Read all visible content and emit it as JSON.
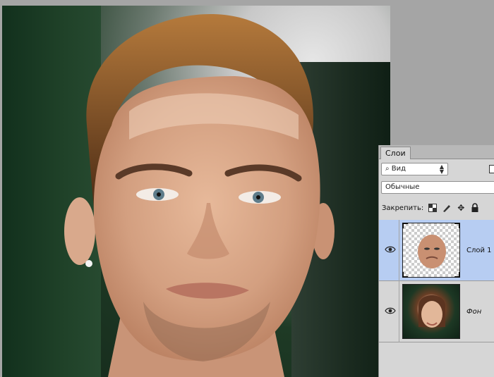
{
  "panel": {
    "tab_label": "Слои",
    "filter": {
      "icon": "search-icon",
      "value": "Вид"
    },
    "blend_mode": "Обычные",
    "lock_label": "Закрепить:",
    "lock_icons": [
      "lock-transparency-icon",
      "lock-paint-icon",
      "lock-move-icon",
      "lock-all-icon"
    ],
    "layers": [
      {
        "name": "Слой 1",
        "active": true,
        "visible": true
      },
      {
        "name": "Фон",
        "active": false,
        "visible": true,
        "italic": true
      }
    ]
  },
  "colors": {
    "panel_bg": "#d6d6d6",
    "active_layer": "#b7cdf2",
    "workspace": "#a5a5a5"
  }
}
